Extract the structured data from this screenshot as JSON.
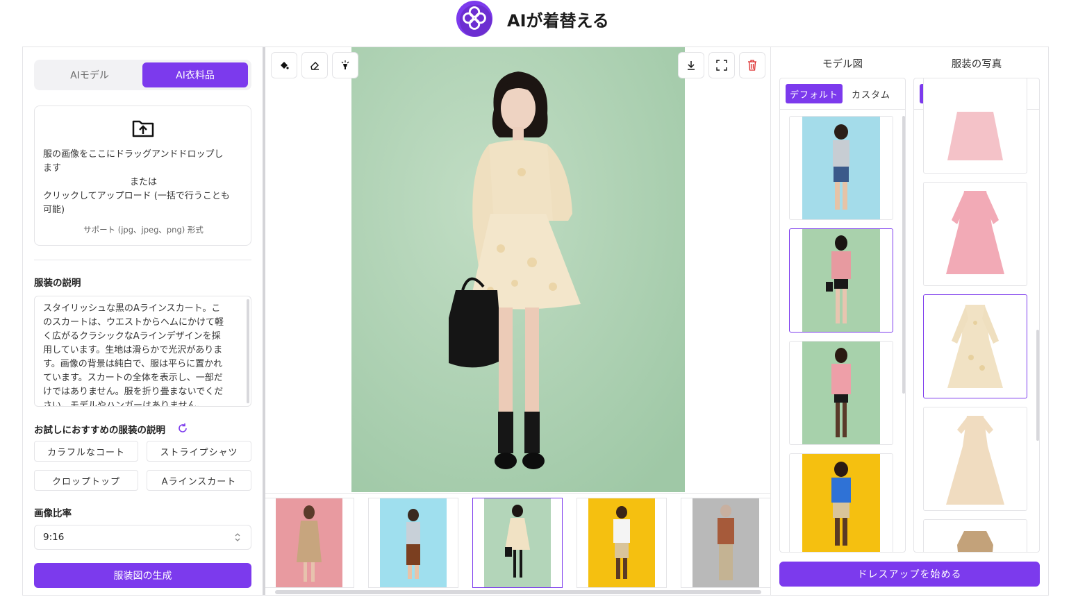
{
  "header": {
    "title": "AIが着替える",
    "logo": "flower-logo"
  },
  "left": {
    "tabs": [
      {
        "label": "AIモデル",
        "active": false
      },
      {
        "label": "AI衣料品",
        "active": true
      }
    ],
    "upload": {
      "icon": "folder-upload-icon",
      "line1": "服の画像をここにドラッグアンドドロップし",
      "line2": "ます",
      "line3": "または",
      "line4": "クリックしてアップロード (一括で行うことも",
      "line5": "可能)",
      "support": "サポート (jpg、jpeg、png) 形式"
    },
    "description_label": "服装の説明",
    "description_lines": [
      "スタイリッシュな黒のAラインスカート。こ",
      "のスカートは、ウエストからヘムにかけて軽",
      "く広がるクラシックなAラインデザインを採",
      "用しています。生地は滑らかで光沢がありま",
      "す。画像の背景は純白で、服は平らに置かれ",
      "ています。スカートの全体を表示し、一部だ",
      "けではありません。服を折り畳まないでくだ",
      "さい。モデルやハンガーはありません。"
    ],
    "suggest_label": "お試しにおすすめの服装の説明",
    "suggestions": [
      "カラフルなコート",
      "ストライプシャツ",
      "クロップトップ",
      "Aラインスカート"
    ],
    "ratio_label": "画像比率",
    "ratio_value": "9:16",
    "generate_label": "服装図の生成"
  },
  "center": {
    "tools_left": [
      "paint-bucket-icon",
      "eraser-icon",
      "magic-wand-icon"
    ],
    "tools_right": [
      "download-icon",
      "fullscreen-icon",
      "trash-icon"
    ],
    "thumbnails": [
      "trench-coat-woman",
      "boy-light-blue",
      "woman-cream-dress",
      "man-yellow-bg",
      "older-man-gray-bg"
    ],
    "selected_thumbnail": 2
  },
  "right": {
    "models_title": "モデル図",
    "clothes_title": "服装の写真",
    "default_label": "デフォルト",
    "custom_label": "カスタム",
    "start_label": "ドレスアップを始める",
    "colors": {
      "accent": "#7c3aed",
      "canvas_bg": "#b3d5b9"
    }
  }
}
